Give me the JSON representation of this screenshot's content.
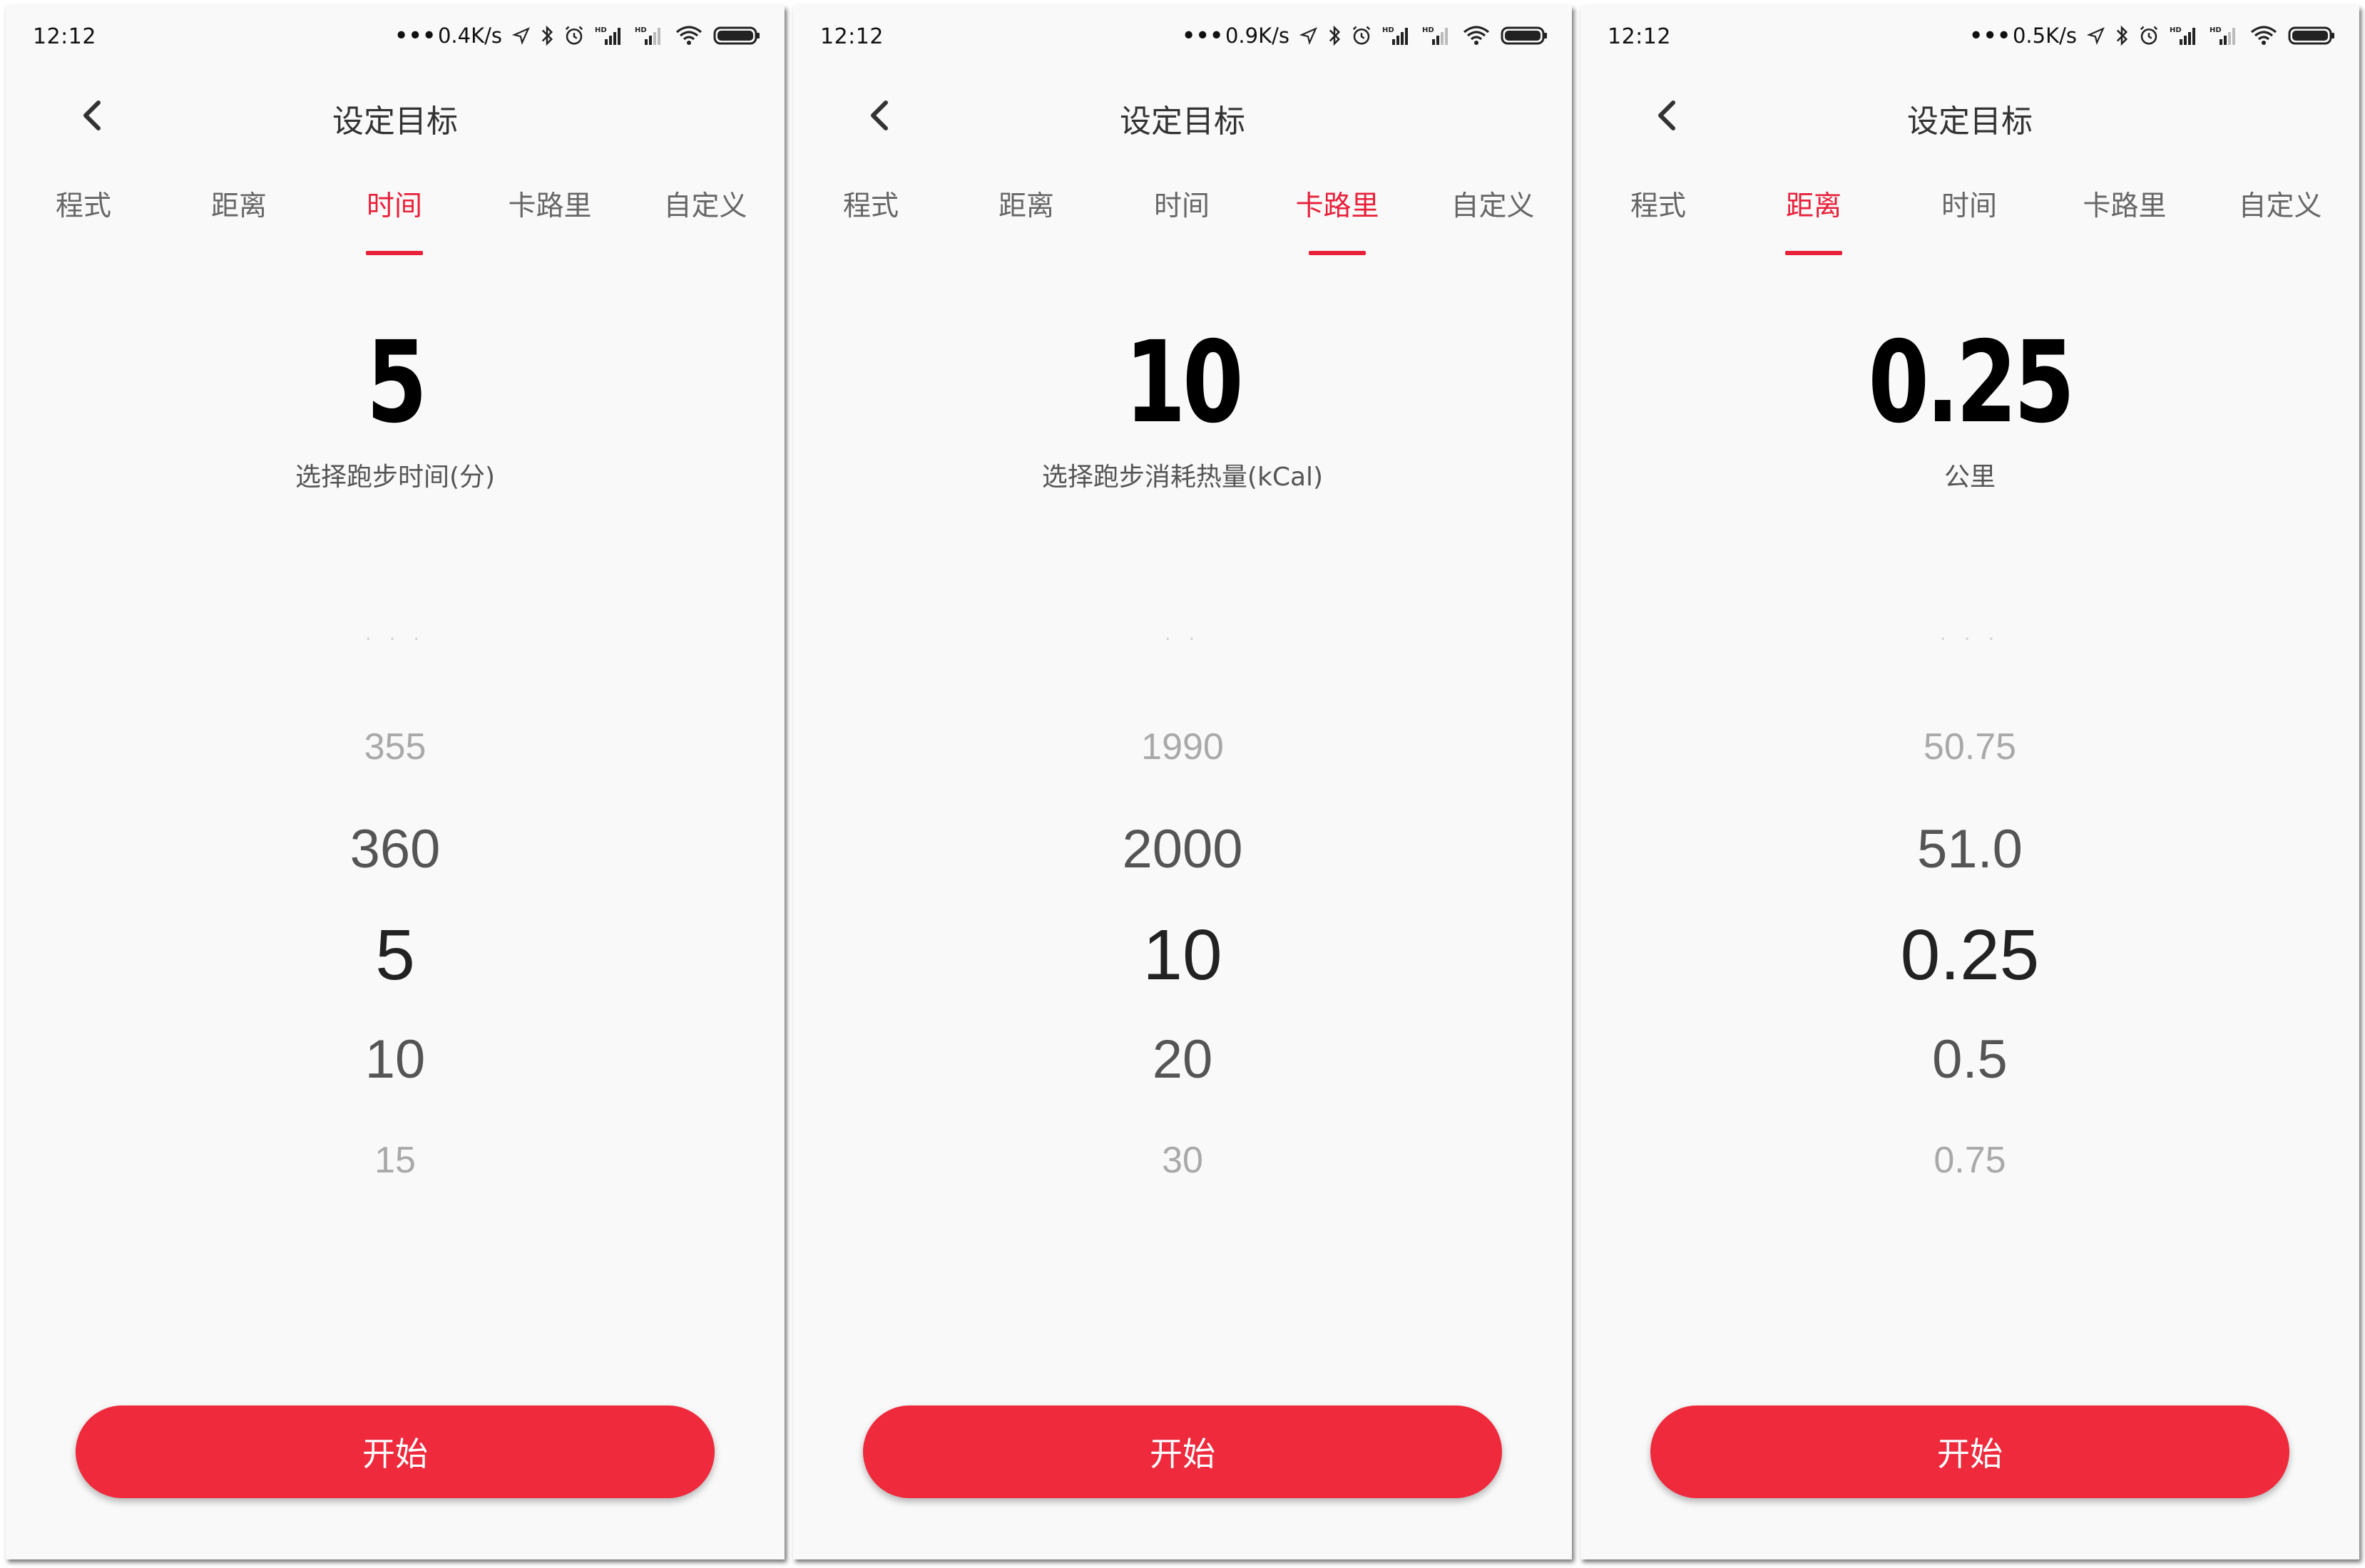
{
  "colors": {
    "accent": "#e8203a",
    "button": "#ee2a3c",
    "background": "#f9f9f9"
  },
  "panels": [
    {
      "status": {
        "time": "12:12",
        "speed": "0.4K/s"
      },
      "header": {
        "title": "设定目标"
      },
      "tabs": [
        {
          "label": "程式",
          "active": false
        },
        {
          "label": "距离",
          "active": false
        },
        {
          "label": "时间",
          "active": true
        },
        {
          "label": "卡路里",
          "active": false
        },
        {
          "label": "自定义",
          "active": false
        }
      ],
      "display": {
        "value": "5",
        "label": "选择跑步时间(分)"
      },
      "picker": {
        "fade_marks": "· · ·",
        "items": [
          "355",
          "360",
          "5",
          "10",
          "15"
        ],
        "selected": "5"
      },
      "button": {
        "label": "开始"
      }
    },
    {
      "status": {
        "time": "12:12",
        "speed": "0.9K/s"
      },
      "header": {
        "title": "设定目标"
      },
      "tabs": [
        {
          "label": "程式",
          "active": false
        },
        {
          "label": "距离",
          "active": false
        },
        {
          "label": "时间",
          "active": false
        },
        {
          "label": "卡路里",
          "active": true
        },
        {
          "label": "自定义",
          "active": false
        }
      ],
      "display": {
        "value": "10",
        "label": "选择跑步消耗热量(kCal)"
      },
      "picker": {
        "fade_marks": "· ·",
        "items": [
          "1990",
          "2000",
          "10",
          "20",
          "30"
        ],
        "selected": "10"
      },
      "button": {
        "label": "开始"
      }
    },
    {
      "status": {
        "time": "12:12",
        "speed": "0.5K/s"
      },
      "header": {
        "title": "设定目标"
      },
      "tabs": [
        {
          "label": "程式",
          "active": false
        },
        {
          "label": "距离",
          "active": true
        },
        {
          "label": "时间",
          "active": false
        },
        {
          "label": "卡路里",
          "active": false
        },
        {
          "label": "自定义",
          "active": false
        }
      ],
      "display": {
        "value": "0.25",
        "label": "公里"
      },
      "picker": {
        "fade_marks": "· · ·",
        "items": [
          "50.75",
          "51.0",
          "0.25",
          "0.5",
          "0.75"
        ],
        "selected": "0.25"
      },
      "button": {
        "label": "开始"
      }
    }
  ]
}
